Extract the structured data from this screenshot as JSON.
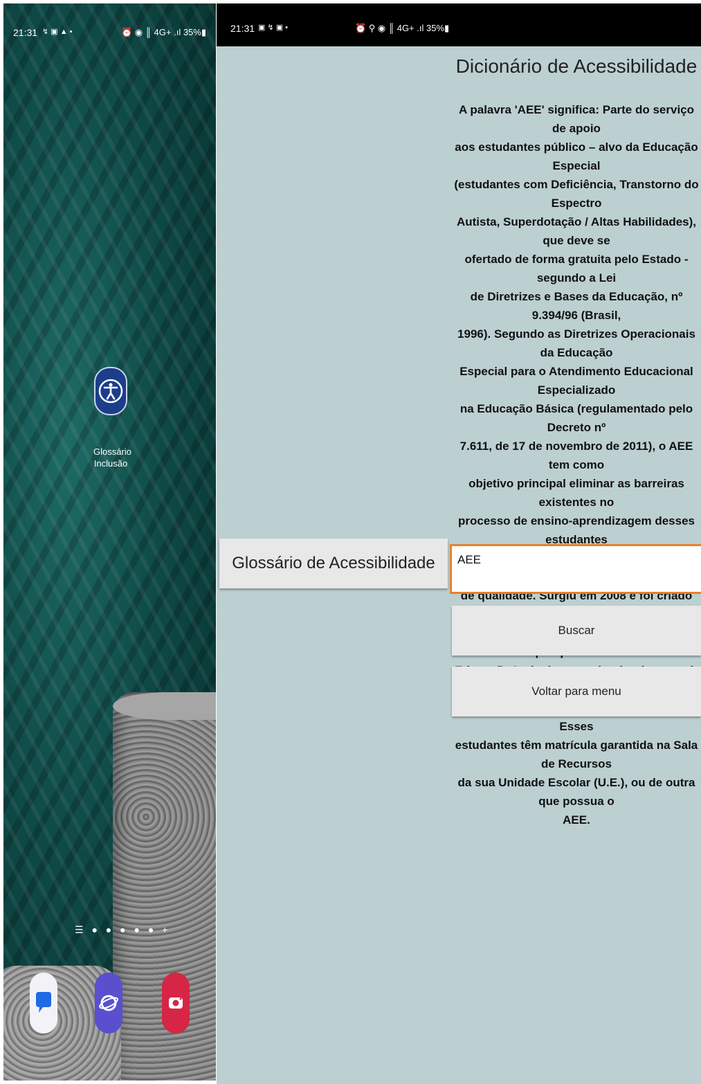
{
  "home": {
    "status": {
      "time": "21:31",
      "left_icons": "↯ ▣ ▲ •",
      "right_icons": "⏰ ◉ ║ 4G+ .ıl 35%▮"
    },
    "app_icon": {
      "label_line1": "Glossário",
      "label_line2": "Inclusão",
      "icon": "accessibility-icon"
    },
    "page_indicator": "☰ ● ● ● ● ● +",
    "dock": [
      {
        "icon": "messages-icon"
      },
      {
        "icon": "internet-icon"
      },
      {
        "icon": "camera-icon"
      }
    ]
  },
  "app": {
    "status": {
      "time": "21:31",
      "left_icons": "▣ ↯ ▣ •",
      "mid_icons": "⏰ ⚲ ◉ ║ 4G+ .ıl 35%▮"
    },
    "title": "Dicionário de Acessibilidade",
    "definition": "A palavra 'AEE' significa:  Parte do serviço de apoio\naos estudantes público – alvo da Educação Especial\n(estudantes com Deficiência, Transtorno do Espectro\nAutista, Superdotação / Altas Habilidades), que deve se\nofertado de forma gratuita pelo Estado - segundo a Lei\nde Diretrizes e Bases da Educação, nº 9.394/96 (Brasil,\n1996). Segundo as Diretrizes Operacionais da Educação\nEspecial para o Atendimento Educacional Especializado\nna Educação Básica (regulamentado pelo Decreto nº\n7.611, de 17 de novembro de 2011), o AEE tem como\nobjetivo principal eliminar as barreiras existentes no\nprocesso de ensino-aprendizagem desses estudantes\ne promover uma educação acessível, com equidade e\nde qualidade. Surgiu em 2008 e foi criado pela Política\nNacional de Educação Especial na perspectiva da\nEducação Inclusiva, com intuito de garantir o direito\nà aprendizagem e de acesso ao currículo. Esses\nestudantes têm matrícula garantida na Sala de Recursos\nda sua Unidade Escolar (U.E.), ou de outra que possua o\nAEE.",
    "glossary_button": "Glossário de Acessibilidade",
    "search_value": "AEE",
    "search_button": "Buscar",
    "menu_button": "Voltar para menu",
    "accent_color": "#e8802a",
    "background_color": "#bccfd1"
  }
}
